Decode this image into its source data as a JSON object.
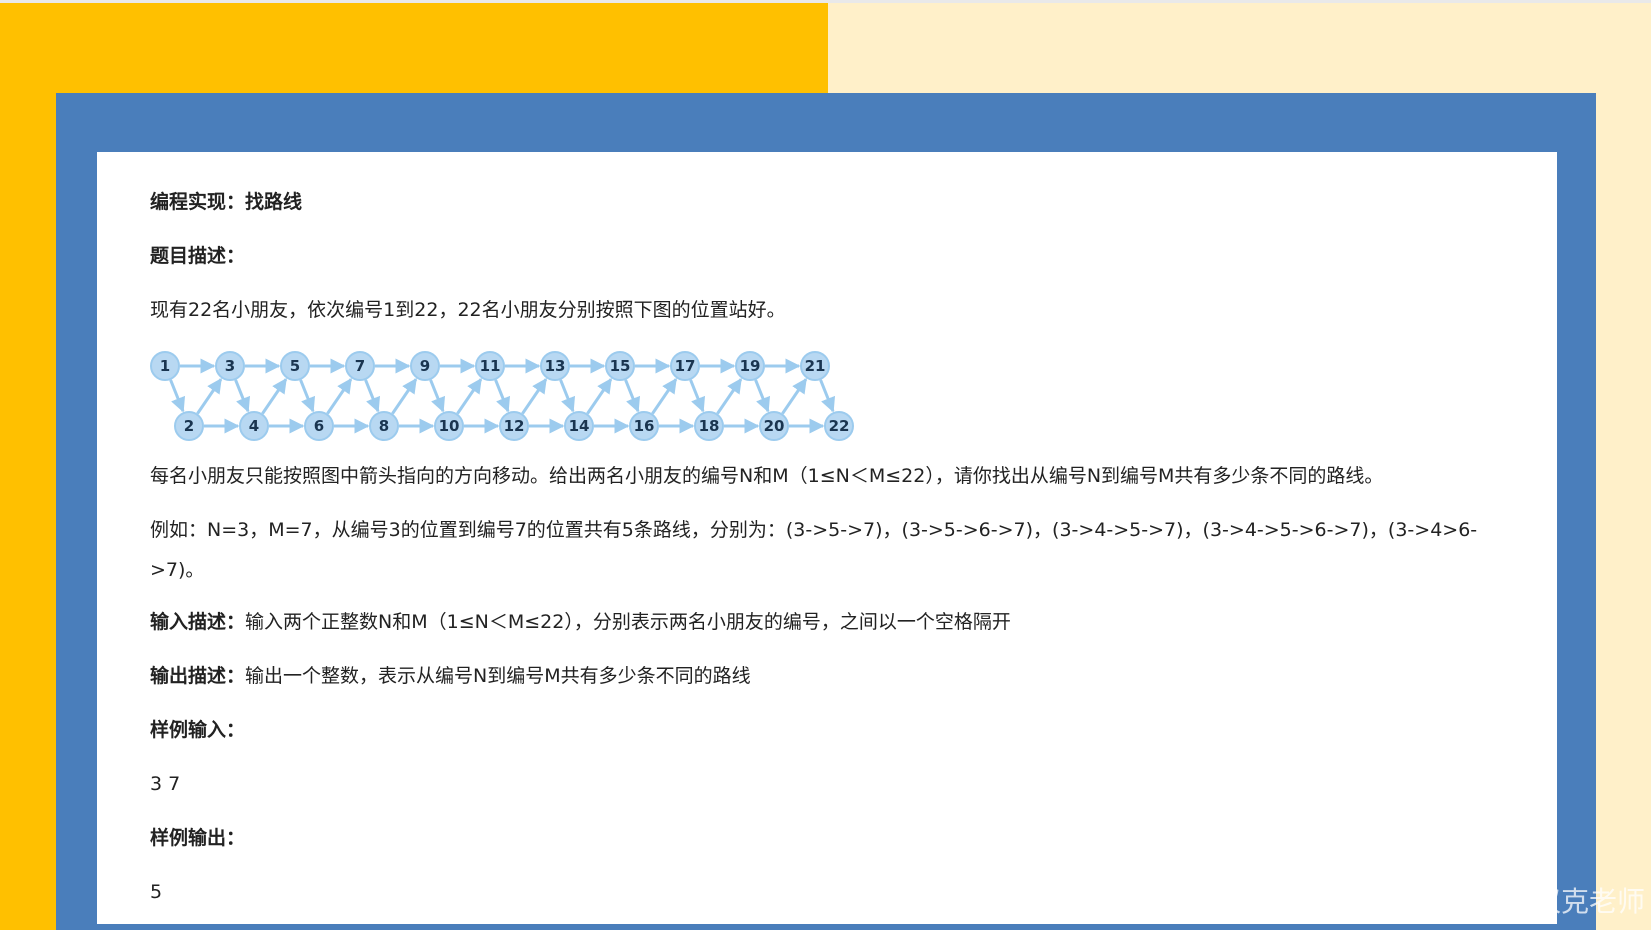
{
  "title": "编程实现：找路线",
  "desc_label": "题目描述：",
  "intro": "现有22名小朋友，依次编号1到22，22名小朋友分别按照下图的位置站好。",
  "diagram": {
    "top_nodes": [
      "1",
      "3",
      "5",
      "7",
      "9",
      "11",
      "13",
      "15",
      "17",
      "19",
      "21"
    ],
    "bottom_nodes": [
      "2",
      "4",
      "6",
      "8",
      "10",
      "12",
      "14",
      "16",
      "18",
      "20",
      "22"
    ]
  },
  "rule": "每名小朋友只能按照图中箭头指向的方向移动。给出两名小朋友的编号N和M（1≤N＜M≤22），请你找出从编号N到编号M共有多少条不同的路线。",
  "example_line1": "例如：N=3，M=7，从编号3的位置到编号7的位置共有5条路线，分别为：(3->5->7)，(3->5->6->7)，(3->4->5->7)，(3->4->5->6->7)，(3->4>6-",
  "example_line2": ">7)。",
  "input_label": "输入描述：",
  "input_text": "输入两个正整数N和M（1≤N＜M≤22），分别表示两名小朋友的编号，之间以一个空格隔开",
  "output_label": "输出描述：",
  "output_text": "输出一个整数，表示从编号N到编号M共有多少条不同的路线",
  "sample_in_label": "样例输入：",
  "sample_in": "3 7",
  "sample_out_label": "样例输出：",
  "sample_out": "5",
  "watermark": "CSDN @汉克老师",
  "colors": {
    "left_bg": "#ffc000",
    "right_bg": "#fff0c9",
    "frame": "#4a7ebb",
    "node_fill": "#b8d8f2",
    "arrow": "#9ccbee"
  }
}
